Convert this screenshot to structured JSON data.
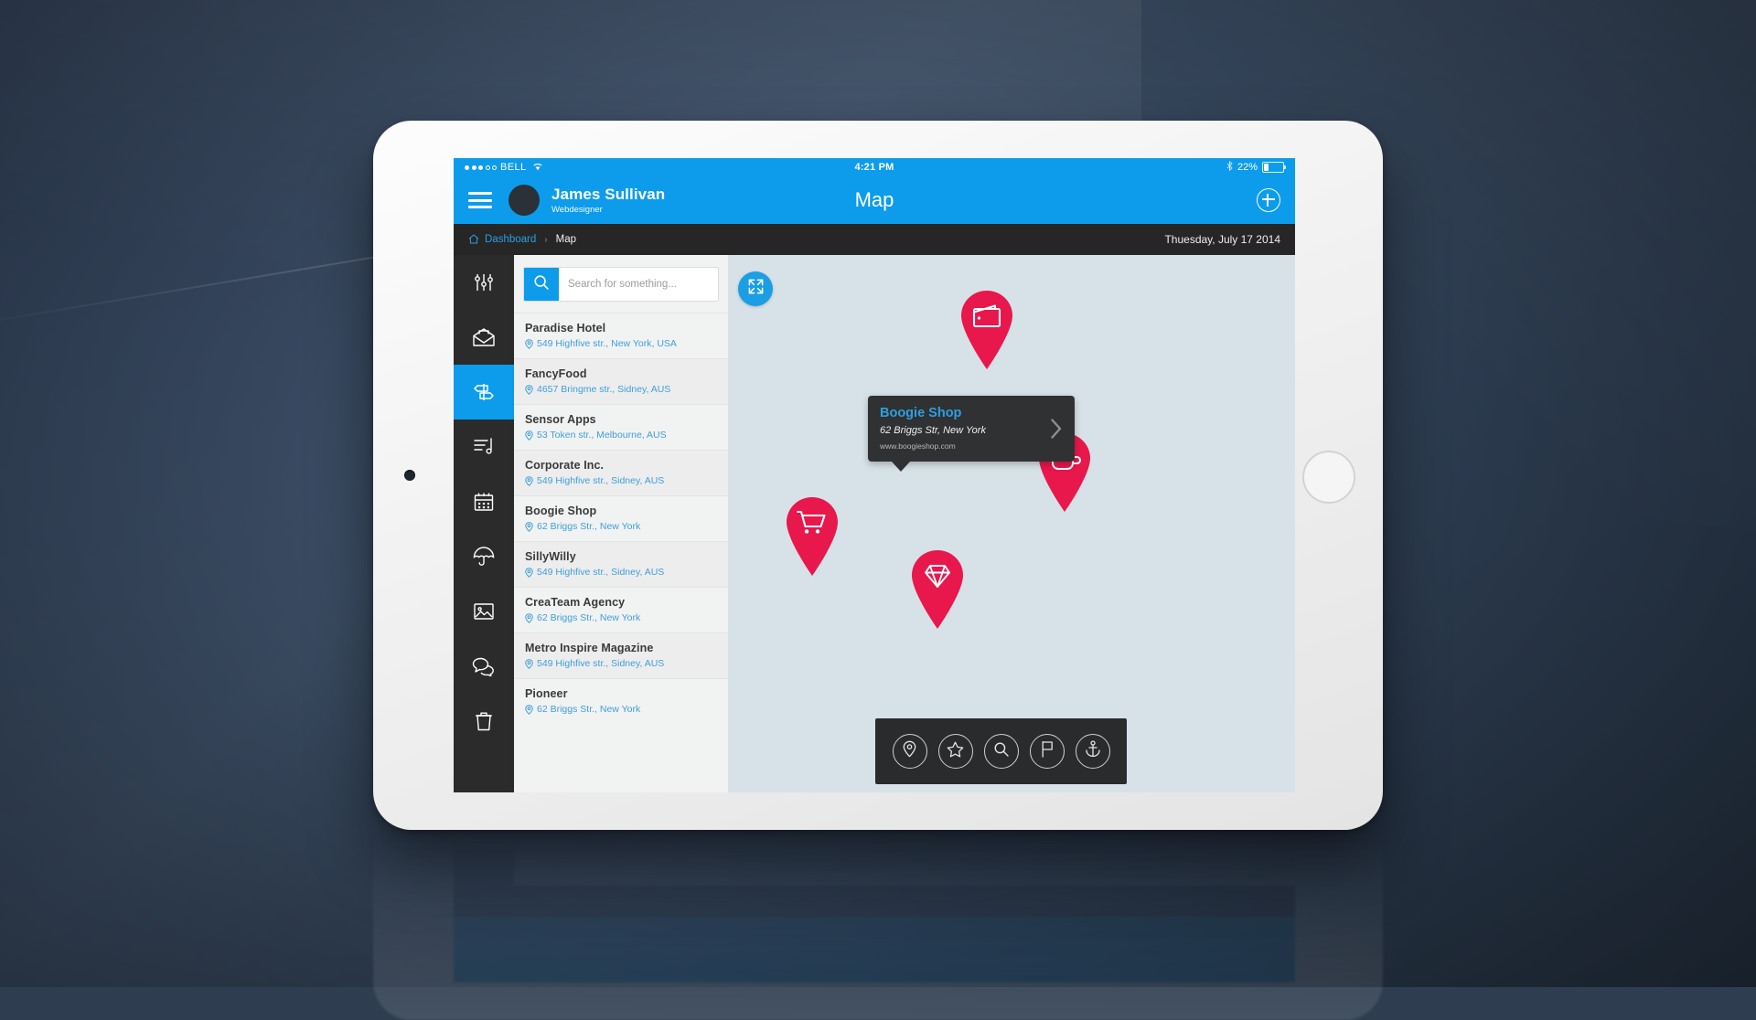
{
  "status_bar": {
    "carrier": "BELL",
    "signal_dots_filled": 3,
    "signal_dots_total": 5,
    "wifi_icon": "wifi-icon",
    "time": "4:21 PM",
    "bluetooth_icon": "bluetooth-icon",
    "battery_percent": "22%"
  },
  "app_bar": {
    "menu_icon": "hamburger-menu-icon",
    "avatar": "user-avatar",
    "user_name": "James Sullivan",
    "user_role": "Webdesigner",
    "title": "Map",
    "add_icon": "plus-circle-icon",
    "accent_color": "#0d9ceb"
  },
  "breadcrumb": {
    "home_icon": "home-icon",
    "root": "Dashboard",
    "separator": "›",
    "current": "Map",
    "date": "Thuesday, July 17 2014"
  },
  "rail": {
    "items": [
      {
        "icon": "sliders-settings-icon",
        "active": false
      },
      {
        "icon": "open-envelope-icon",
        "active": false
      },
      {
        "icon": "signpost-icon",
        "active": true
      },
      {
        "icon": "music-playlist-icon",
        "active": false
      },
      {
        "icon": "calendar-icon",
        "active": false
      },
      {
        "icon": "umbrella-icon",
        "active": false
      },
      {
        "icon": "image-icon",
        "active": false
      },
      {
        "icon": "chat-bubbles-icon",
        "active": false
      },
      {
        "icon": "trash-icon",
        "active": false
      }
    ]
  },
  "search": {
    "icon": "search-icon",
    "placeholder": "Search for something...",
    "value": ""
  },
  "places": [
    {
      "name": "Paradise Hotel",
      "address": "549 Highfive str., New York, USA"
    },
    {
      "name": "FancyFood",
      "address": "4657 Bringme str., Sidney, AUS"
    },
    {
      "name": "Sensor Apps",
      "address": "53 Token str., Melbourne, AUS"
    },
    {
      "name": "Corporate Inc.",
      "address": "549 Highfive str., Sidney, AUS"
    },
    {
      "name": "Boogie Shop",
      "address": "62 Briggs Str., New York"
    },
    {
      "name": "SillyWilly",
      "address": "549 Highfive str., Sidney, AUS"
    },
    {
      "name": "CreaTeam Agency",
      "address": "62 Briggs Str., New York"
    },
    {
      "name": "Metro Inspire Magazine",
      "address": "549 Highfive str., Sidney, AUS"
    },
    {
      "name": "Pioneer",
      "address": "62 Briggs Str., New York"
    }
  ],
  "map": {
    "expand_icon": "expand-fullscreen-icon",
    "background_color": "#d7e2e8",
    "pin_color": "#e8174c",
    "pins": [
      {
        "icon": "wallet-icon",
        "label": "wallet"
      },
      {
        "icon": "shopping-cart-icon",
        "label": "shopping cart"
      },
      {
        "icon": "diamond-icon",
        "label": "diamond"
      },
      {
        "icon": "coffee-cup-icon",
        "label": "coffee"
      }
    ],
    "popup": {
      "title": "Boogie Shop",
      "address": "62 Briggs Str, New York",
      "url": "www.boogieshop.com",
      "chevron_icon": "chevron-right-icon"
    },
    "tools": [
      {
        "icon": "map-pin-icon"
      },
      {
        "icon": "star-icon"
      },
      {
        "icon": "search-icon"
      },
      {
        "icon": "flag-icon"
      },
      {
        "icon": "anchor-icon"
      }
    ]
  }
}
